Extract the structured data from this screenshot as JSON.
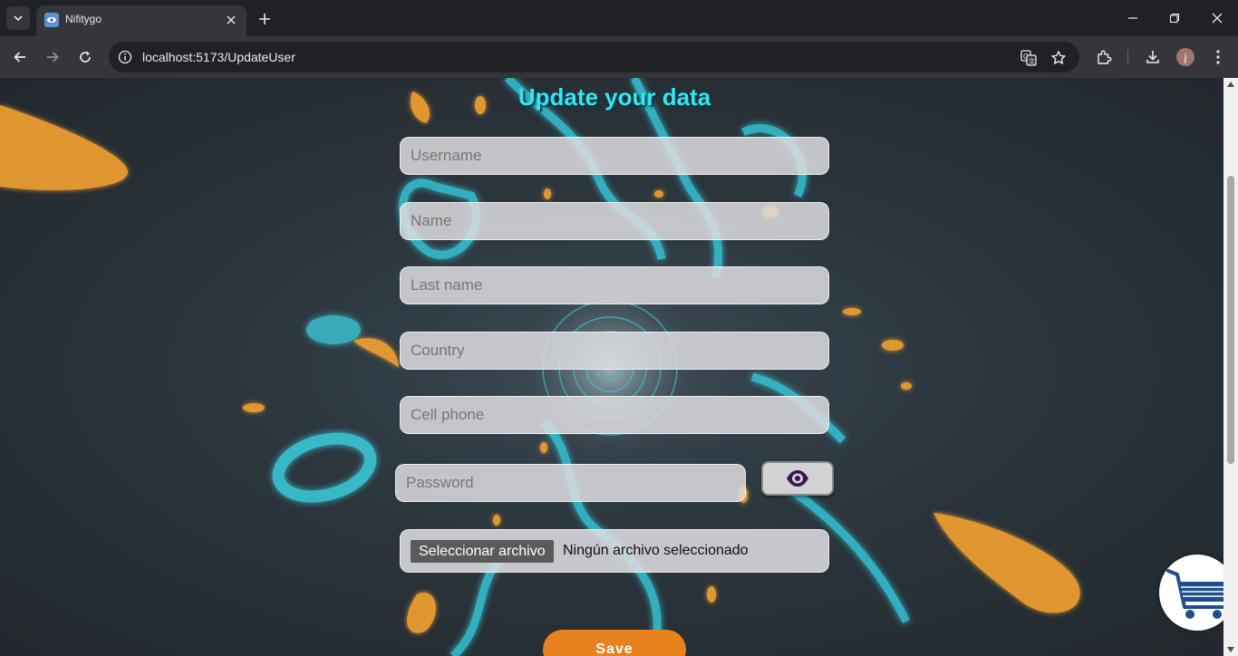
{
  "browser": {
    "tab_title": "Nifitygo",
    "url": "localhost:5173/UpdateUser",
    "profile_initial": "j"
  },
  "form": {
    "title": "Update your data",
    "username_placeholder": "Username",
    "name_placeholder": "Name",
    "lastname_placeholder": "Last name",
    "country_placeholder": "Country",
    "cellphone_placeholder": "Cell phone",
    "password_placeholder": "Password",
    "file_button_label": "Seleccionar archivo",
    "file_status": "Ningún archivo seleccionado",
    "save_label": "Save"
  },
  "icons": {
    "password_toggle": "eye-icon",
    "floating_action": "shopping-cart-icon"
  },
  "colors": {
    "title": "#36e6ee",
    "save_button": "#e8821e",
    "eye_icon": "#3a1650",
    "cart_icon": "#1f4e8c"
  }
}
